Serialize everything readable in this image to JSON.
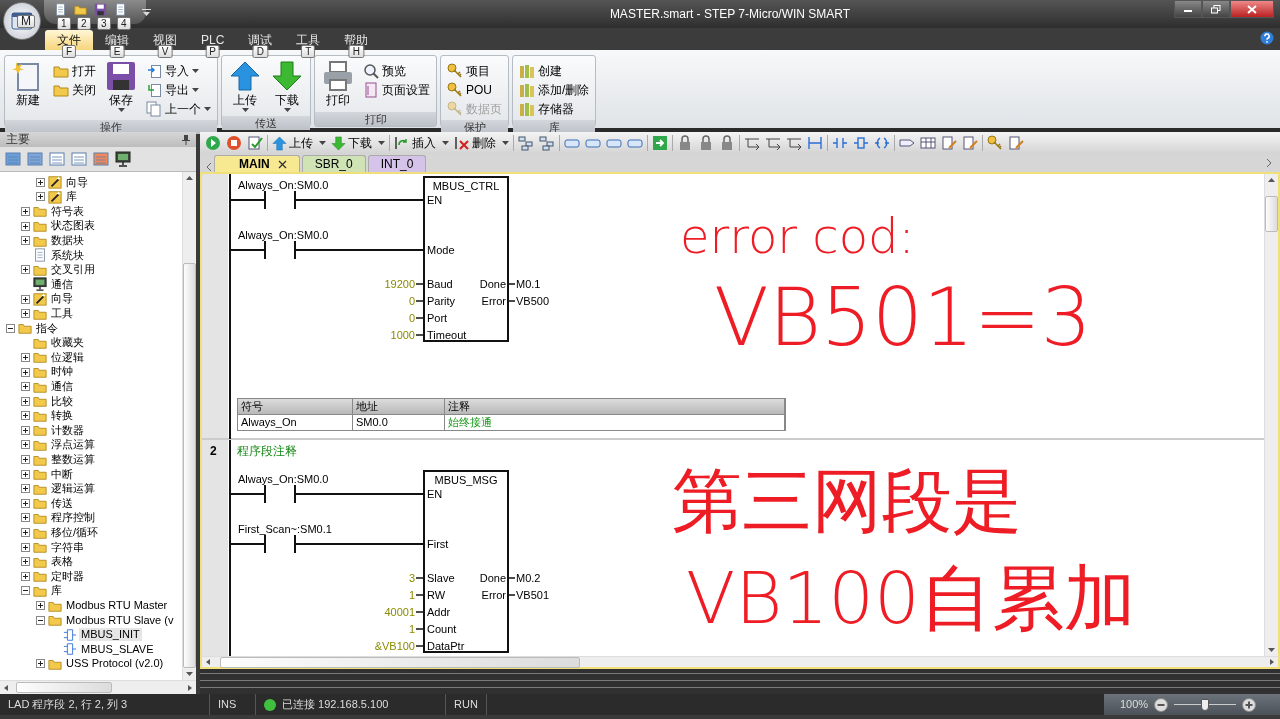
{
  "app_button": {
    "keytip": "M"
  },
  "quick_access": [
    {
      "keytip": "1"
    },
    {
      "keytip": "2"
    },
    {
      "keytip": "3"
    },
    {
      "keytip": "4"
    }
  ],
  "window": {
    "title": "MASTER.smart - STEP 7-Micro/WIN SMART"
  },
  "ribbon_tabs": [
    {
      "label": "文件",
      "keytip": "F",
      "selected": true
    },
    {
      "label": "编辑",
      "keytip": "E",
      "selected": false
    },
    {
      "label": "视图",
      "keytip": "V",
      "selected": false
    },
    {
      "label": "PLC",
      "keytip": "P",
      "selected": false
    },
    {
      "label": "调试",
      "keytip": "D",
      "selected": false
    },
    {
      "label": "工具",
      "keytip": "T",
      "selected": false
    },
    {
      "label": "帮助",
      "keytip": "H",
      "selected": false
    }
  ],
  "ribbon_groups": [
    {
      "title": "操作",
      "items": [
        {
          "label": "新建",
          "kind": "large"
        },
        {
          "label": "打开",
          "kind": "small"
        },
        {
          "label": "关闭",
          "kind": "small"
        },
        {
          "label": "保存",
          "kind": "large",
          "dropdown": true
        },
        {
          "label": "导入",
          "kind": "small",
          "dropdown": true
        },
        {
          "label": "导出",
          "kind": "small",
          "dropdown": true
        },
        {
          "label": "上一个",
          "kind": "small",
          "dropdown": true
        }
      ]
    },
    {
      "title": "传送",
      "items": [
        {
          "label": "上传",
          "kind": "large",
          "dropdown": true
        },
        {
          "label": "下载",
          "kind": "large",
          "dropdown": true
        }
      ]
    },
    {
      "title": "打印",
      "items": [
        {
          "label": "打印",
          "kind": "large"
        },
        {
          "label": "预览",
          "kind": "small"
        },
        {
          "label": "页面设置",
          "kind": "small"
        }
      ]
    },
    {
      "title": "保护",
      "items": [
        {
          "label": "项目",
          "kind": "small"
        },
        {
          "label": "POU",
          "kind": "small"
        },
        {
          "label": "数据页",
          "kind": "small",
          "disabled": true
        }
      ]
    },
    {
      "title": "库",
      "items": [
        {
          "label": "创建",
          "kind": "small"
        },
        {
          "label": "添加/删除",
          "kind": "small"
        },
        {
          "label": "存储器",
          "kind": "small"
        }
      ]
    }
  ],
  "left_pane": {
    "title": "主要",
    "tree": [
      {
        "children": [
          {
            "children": [
              {
                "label": "向导",
                "kind": "wizard",
                "expanded": false
              },
              {
                "label": "库",
                "kind": "wizard",
                "expanded": false
              }
            ]
          },
          {
            "label": "符号表",
            "kind": "folder",
            "expanded": false
          },
          {
            "label": "状态图表",
            "kind": "folder",
            "expanded": false
          },
          {
            "label": "数据块",
            "kind": "folder",
            "expanded": false
          },
          {
            "label": "系统块",
            "kind": "doc"
          },
          {
            "label": "交叉引用",
            "kind": "folder",
            "expanded": false
          },
          {
            "label": "通信",
            "kind": "monitor"
          },
          {
            "label": "向导",
            "kind": "wizard",
            "expanded": false
          },
          {
            "label": "工具",
            "kind": "folder",
            "expanded": false
          }
        ]
      },
      {
        "label": "指令",
        "kind": "folder",
        "expanded": true,
        "children": [
          {
            "label": "收藏夹",
            "kind": "folder"
          },
          {
            "label": "位逻辑",
            "kind": "folder",
            "expanded": false
          },
          {
            "label": "时钟",
            "kind": "folder",
            "expanded": false
          },
          {
            "label": "通信",
            "kind": "folder",
            "expanded": false
          },
          {
            "label": "比较",
            "kind": "folder",
            "expanded": false
          },
          {
            "label": "转换",
            "kind": "folder",
            "expanded": false
          },
          {
            "label": "计数器",
            "kind": "folder",
            "expanded": false
          },
          {
            "label": "浮点运算",
            "kind": "folder",
            "expanded": false
          },
          {
            "label": "整数运算",
            "kind": "folder",
            "expanded": false
          },
          {
            "label": "中断",
            "kind": "folder",
            "expanded": false
          },
          {
            "label": "逻辑运算",
            "kind": "folder",
            "expanded": false
          },
          {
            "label": "传送",
            "kind": "folder",
            "expanded": false
          },
          {
            "label": "程序控制",
            "kind": "folder",
            "expanded": false
          },
          {
            "label": "移位/循环",
            "kind": "folder",
            "expanded": false
          },
          {
            "label": "字符串",
            "kind": "folder",
            "expanded": false
          },
          {
            "label": "表格",
            "kind": "folder",
            "expanded": false
          },
          {
            "label": "定时器",
            "kind": "folder",
            "expanded": false
          },
          {
            "label": "库",
            "kind": "folder",
            "expanded": true,
            "children": [
              {
                "label": "Modbus RTU Master",
                "kind": "folder",
                "expanded": false
              },
              {
                "label": "Modbus RTU Slave (v",
                "kind": "folder",
                "expanded": true,
                "children": [
                  {
                    "label": "MBUS_INIT",
                    "kind": "block",
                    "selected": true
                  },
                  {
                    "label": "MBUS_SLAVE",
                    "kind": "block",
                    "selected": false
                  }
                ]
              },
              {
                "label": "USS Protocol (v2.0)",
                "kind": "folder",
                "expanded": false
              }
            ]
          }
        ]
      }
    ]
  },
  "editor": {
    "toolbar_buttons": [
      {
        "label": "上传",
        "dropdown": true
      },
      {
        "label": "下载",
        "dropdown": true
      },
      {
        "label": "插入",
        "dropdown": true
      },
      {
        "label": "删除",
        "dropdown": true
      }
    ],
    "tabs": [
      {
        "label": "MAIN",
        "selected": true,
        "color": "#f7e992"
      },
      {
        "label": "SBR_0",
        "selected": false,
        "color": "#cfe3b4"
      },
      {
        "label": "INT_0",
        "selected": false,
        "color": "#d5c3ea"
      }
    ],
    "networks": [
      {
        "contacts": [
          {
            "label": "Always_On:SM0.0"
          },
          {
            "label": "Always_On:SM0.0"
          }
        ],
        "block": {
          "title": "MBUS_CTRL",
          "inputs": [
            {
              "pin": "EN"
            },
            {
              "pin": "Mode"
            },
            {
              "pin": "Baud",
              "value": "19200"
            },
            {
              "pin": "Parity",
              "value": "0"
            },
            {
              "pin": "Port",
              "value": "0"
            },
            {
              "pin": "Timeout",
              "value": "1000"
            }
          ],
          "outputs": [
            {
              "pin": "Done",
              "value": "M0.1"
            },
            {
              "pin": "Error",
              "value": "VB500"
            }
          ]
        },
        "symbol_table": {
          "columns": [
            "符号",
            "地址",
            "注释"
          ],
          "rows": [
            [
              "Always_On",
              "SM0.0",
              "始终接通"
            ]
          ]
        }
      },
      {
        "number": "2",
        "comment": "程序段注释",
        "contacts": [
          {
            "label": "Always_On:SM0.0"
          },
          {
            "label": "First_Scan~:SM0.1"
          }
        ],
        "block": {
          "title": "MBUS_MSG",
          "inputs": [
            {
              "pin": "EN"
            },
            {
              "pin": "First"
            },
            {
              "pin": "Slave",
              "value": "3"
            },
            {
              "pin": "RW",
              "value": "1"
            },
            {
              "pin": "Addr",
              "value": "40001"
            },
            {
              "pin": "Count",
              "value": "1"
            },
            {
              "pin": "DataPtr",
              "value": "&VB100"
            }
          ],
          "outputs": [
            {
              "pin": "Done",
              "value": "M0.2"
            },
            {
              "pin": "Error",
              "value": "VB501"
            }
          ]
        }
      }
    ],
    "annotations": [
      {
        "text": "error cod:"
      },
      {
        "text": "VB501=3"
      },
      {
        "text": "第三网段是"
      },
      {
        "text": "VB100自累加"
      }
    ]
  },
  "status_bar": {
    "position": "LAD 程序段 2, 行 2, 列 3",
    "mode": "INS",
    "connected": true,
    "connection": "已连接 192.168.5.100",
    "plc_state": "RUN",
    "zoom": {
      "reading": "100%",
      "level": 0.5
    }
  }
}
